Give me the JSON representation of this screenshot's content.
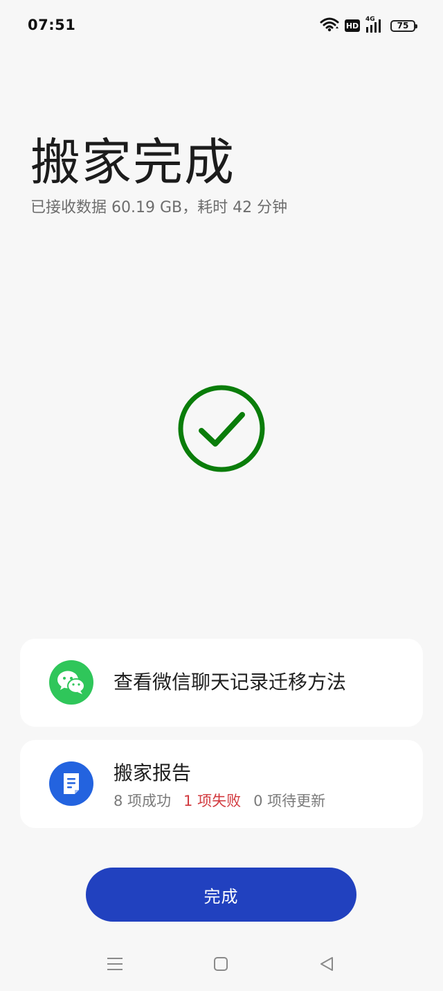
{
  "status_bar": {
    "time": "07:51",
    "hd_label": "HD",
    "network_label": "4G",
    "battery_level": "75",
    "icons": [
      "wifi-icon",
      "hd-icon",
      "signal-4g-icon",
      "battery-icon"
    ]
  },
  "header": {
    "title": "搬家完成",
    "subtitle": "已接收数据 60.19 GB，耗时 42 分钟"
  },
  "success": {
    "icon": "check-circle-icon",
    "color": "#0a7d0a"
  },
  "wechat_card": {
    "icon": "wechat-icon",
    "label": "查看微信聊天记录迁移方法",
    "icon_color": "#2fc65a"
  },
  "report_card": {
    "icon": "document-icon",
    "title": "搬家报告",
    "success_text": "8 项成功",
    "failed_text": "1 项失败",
    "pending_text": "0 项待更新",
    "icon_color": "#2363df",
    "failed_color": "#d23a3f"
  },
  "done_button": {
    "label": "完成",
    "color": "#2141bf"
  },
  "nav_bar": {
    "items": [
      "menu-icon",
      "home-icon",
      "back-icon"
    ]
  }
}
